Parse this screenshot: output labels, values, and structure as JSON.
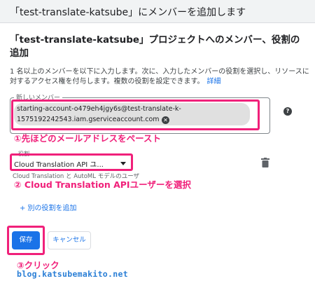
{
  "dialog": {
    "title": "「test-translate-katsube」にメンバーを追加します",
    "heading": "「test-translate-katsube」プロジェクトへのメンバー、役割の追加",
    "description": "1 名以上のメンバーを以下に入力します。次に、入力したメンバーの役割を選択し、リソースに対するアクセス権を付与します。複数の役割を設定できます。",
    "details_link": "詳細"
  },
  "members_field": {
    "label": "新しいメンバー",
    "chip_line1": "starting-account-o479eh4jgy6s@test-translate-k-",
    "chip_line2": "1575192242543.iam.gserviceaccount.com",
    "help_icon": "?",
    "remove_icon": "✕"
  },
  "role_field": {
    "label": "役割",
    "selected": "Cloud Translation API ユ...",
    "hint": "Cloud Translation と AutoML モデルのユーザ"
  },
  "add_role_link": "+ 別の役割を追加",
  "buttons": {
    "save": "保存",
    "cancel": "キャンセル"
  },
  "annotations": {
    "step1": "①先ほどのメールアドレスをペースト",
    "step2": "② Cloud Translation APIユーザーを選択",
    "step3": "③クリック"
  },
  "watermark": "blog.katsubemakito.net",
  "colors": {
    "annotation": "#f0207a",
    "primary": "#1a73e8",
    "watermark": "#2b7fd6"
  },
  "icons": [
    "help-icon",
    "chip-remove-icon",
    "dropdown-arrow-icon",
    "trash-icon"
  ]
}
